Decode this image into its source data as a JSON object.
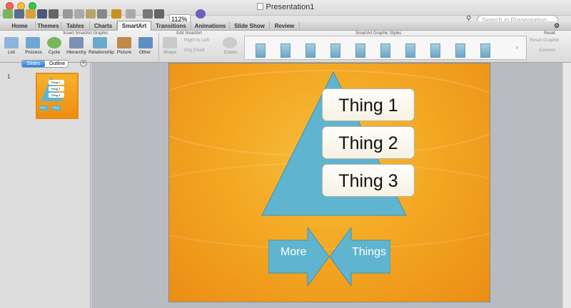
{
  "window": {
    "title": "Presentation1"
  },
  "toolbar": {
    "zoom": "112%",
    "search_placeholder": "Search in Presentation"
  },
  "tabs": [
    "Home",
    "Themes",
    "Tables",
    "Charts",
    "SmartArt",
    "Transitions",
    "Animations",
    "Slide Show",
    "Review"
  ],
  "active_tab": "SmartArt",
  "ribbon": {
    "groups": {
      "insert": "Insert SmartArt Graphic",
      "edit": "Edit SmartArt",
      "styles": "SmartArt Graphic Styles",
      "reset": "Reset"
    },
    "insert_buttons": [
      "List",
      "Process",
      "Cycle",
      "Hierarchy",
      "Relationship",
      "Picture",
      "Other"
    ],
    "edit_buttons": {
      "shape": "Shape",
      "rtl": "Right to Left",
      "org": "Org Chart",
      "colors": "Colors"
    },
    "reset_buttons": {
      "reset": "Reset Graphic",
      "convert": "Convert"
    }
  },
  "sidebar": {
    "tabs": [
      "Slides",
      "Outline"
    ],
    "slide_number": "1"
  },
  "slide": {
    "items": [
      "Thing 1",
      "Thing 2",
      "Thing 3"
    ],
    "left_arrow": "More",
    "right_arrow": "Things"
  },
  "colors": {
    "accent": "#5fb5cf",
    "slide_bg": "#f3a823"
  }
}
